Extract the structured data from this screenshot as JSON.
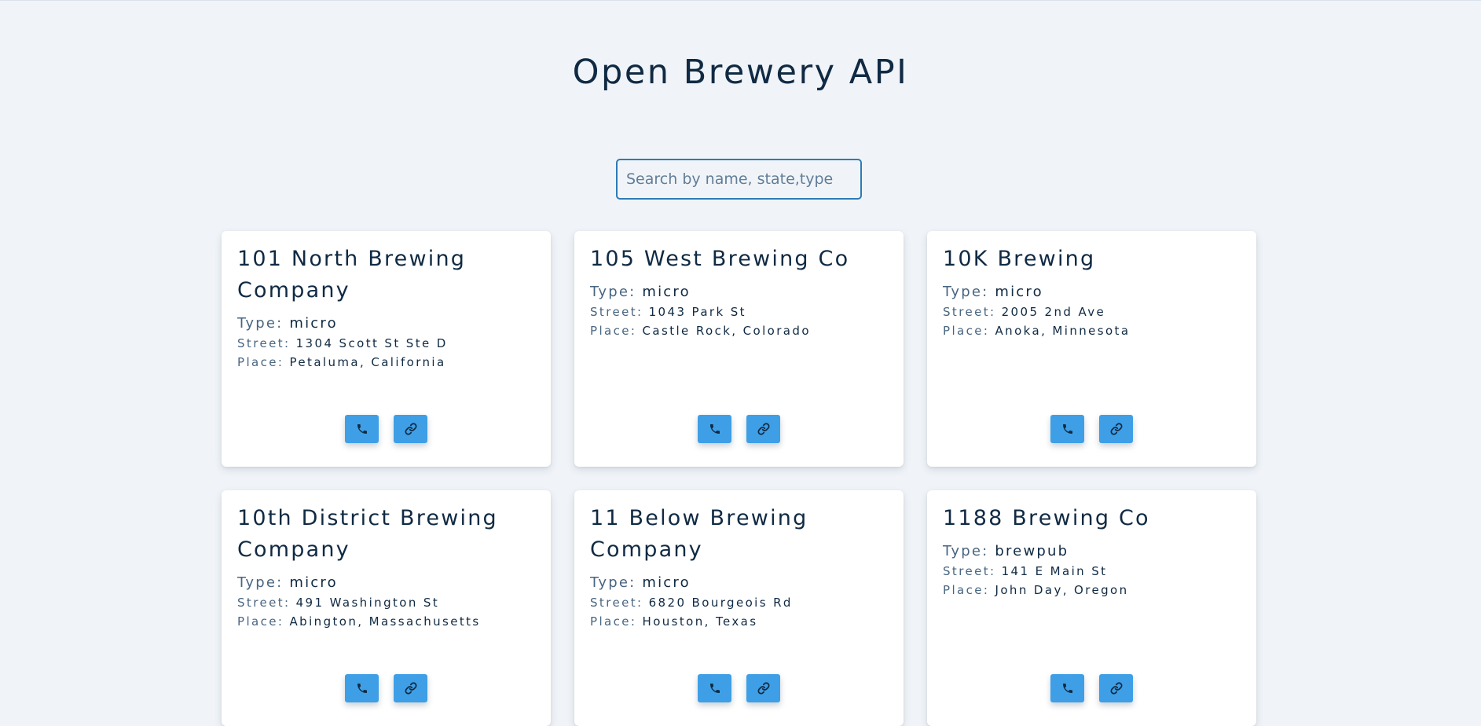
{
  "page": {
    "title": "Open Brewery API"
  },
  "search": {
    "placeholder": "Search by name, state,type",
    "value": ""
  },
  "labels": {
    "type": "Type:",
    "street": "Street:",
    "place": "Place:"
  },
  "icons": {
    "phone": "phone-icon",
    "link": "link-icon"
  },
  "colors": {
    "background": "#f0f4f8",
    "title_text": "#102a43",
    "search_border": "#2d7bb6",
    "button_accent": "#3e9fe6"
  },
  "breweries": [
    {
      "name": "101 North Brewing Company",
      "type": "micro",
      "street": "1304 Scott St Ste D",
      "place": "Petaluma, California"
    },
    {
      "name": "105 West Brewing Co",
      "type": "micro",
      "street": "1043 Park St",
      "place": "Castle Rock, Colorado"
    },
    {
      "name": "10K Brewing",
      "type": "micro",
      "street": "2005 2nd Ave",
      "place": "Anoka, Minnesota"
    },
    {
      "name": "10th District Brewing Company",
      "type": "micro",
      "street": "491 Washington St",
      "place": "Abington, Massachusetts"
    },
    {
      "name": "11 Below Brewing Company",
      "type": "micro",
      "street": "6820 Bourgeois Rd",
      "place": "Houston, Texas"
    },
    {
      "name": "1188 Brewing Co",
      "type": "brewpub",
      "street": "141 E Main St",
      "place": "John Day, Oregon"
    }
  ]
}
